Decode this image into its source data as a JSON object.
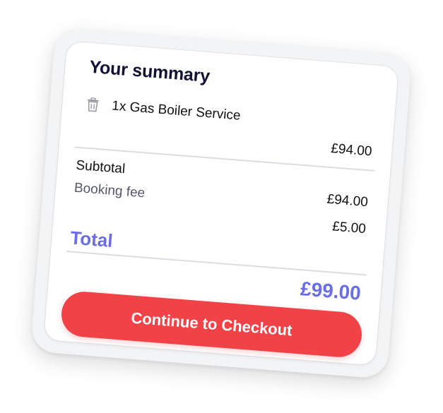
{
  "summary": {
    "title": "Your summary",
    "item": {
      "label": "1x Gas Boiler Service",
      "price": "£94.00",
      "icon": "trash-icon"
    },
    "subtotal": {
      "label": "Subtotal",
      "value": "£94.00"
    },
    "booking_fee": {
      "label": "Booking fee",
      "value": "£5.00"
    },
    "total": {
      "label": "Total",
      "value": "£99.00"
    },
    "checkout_label": "Continue to Checkout"
  },
  "colors": {
    "title": "#111236",
    "accent": "#6a6ee6",
    "button": "#f04247",
    "muted_text": "#55566a"
  }
}
